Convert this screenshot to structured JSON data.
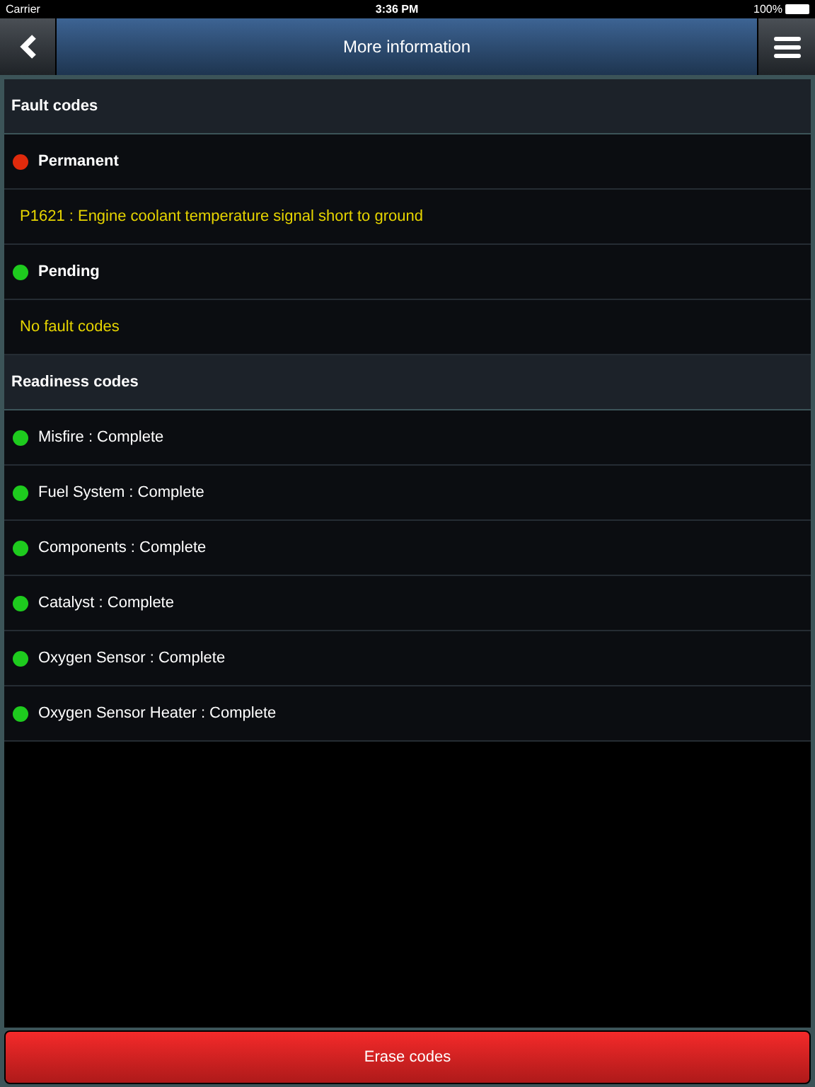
{
  "status_bar": {
    "carrier": "Carrier",
    "time": "3:36 PM",
    "battery": "100%"
  },
  "nav": {
    "title": "More information"
  },
  "rows": [
    {
      "kind": "header",
      "text": "Fault codes"
    },
    {
      "kind": "status",
      "text": "Permanent",
      "color": "#e02a0c"
    },
    {
      "kind": "code",
      "text": "P1621 : Engine coolant temperature signal short to ground"
    },
    {
      "kind": "status",
      "text": "Pending",
      "color": "#1ecb1e"
    },
    {
      "kind": "code",
      "text": "No fault codes"
    },
    {
      "kind": "header",
      "text": "Readiness codes"
    },
    {
      "kind": "item",
      "text": "Misfire : Complete",
      "color": "#1ecb1e"
    },
    {
      "kind": "item",
      "text": "Fuel System : Complete",
      "color": "#1ecb1e"
    },
    {
      "kind": "item",
      "text": "Components : Complete",
      "color": "#1ecb1e"
    },
    {
      "kind": "item",
      "text": "Catalyst : Complete",
      "color": "#1ecb1e"
    },
    {
      "kind": "item",
      "text": "Oxygen Sensor : Complete",
      "color": "#1ecb1e"
    },
    {
      "kind": "item",
      "text": "Oxygen Sensor Heater : Complete",
      "color": "#1ecb1e"
    }
  ],
  "erase_button": "Erase codes"
}
